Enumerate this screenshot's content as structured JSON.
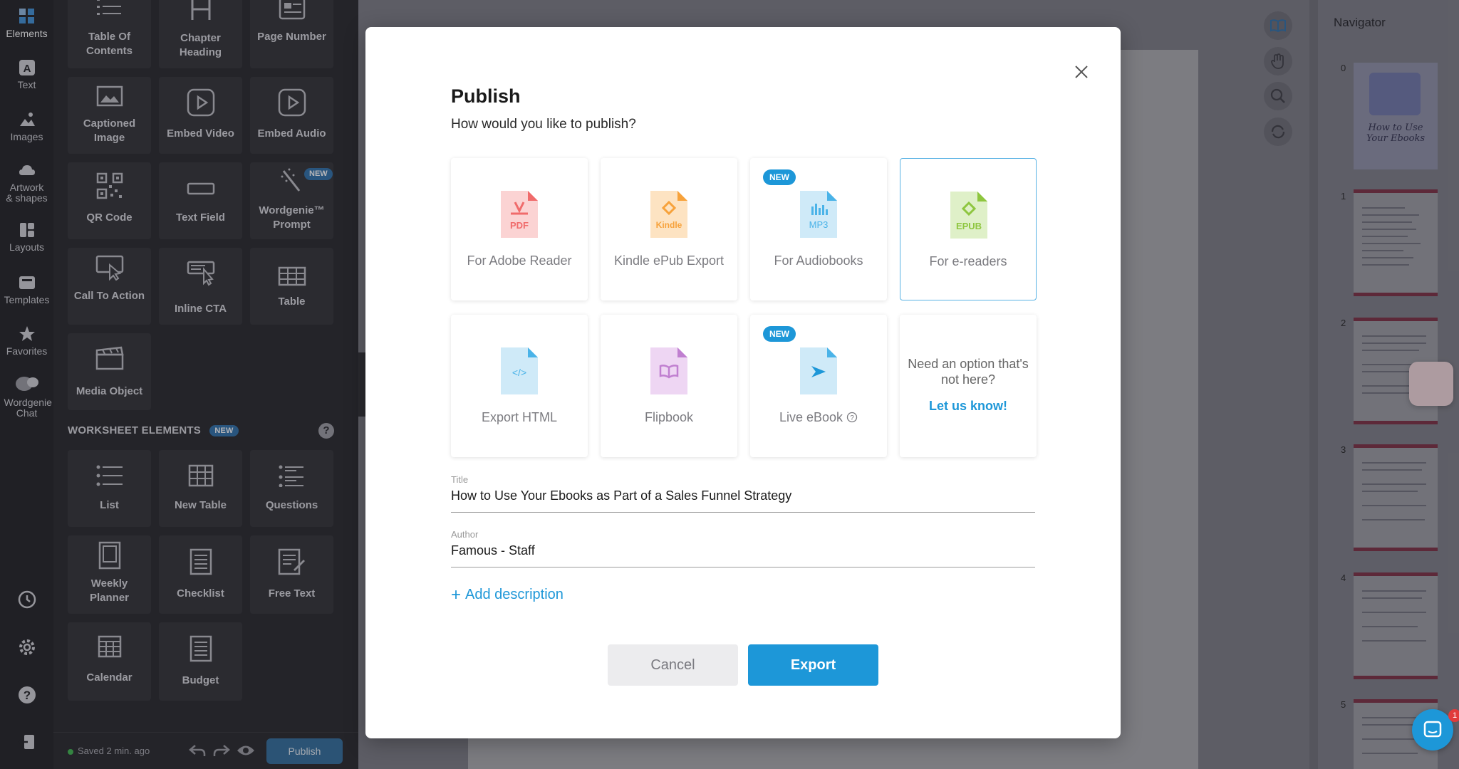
{
  "rail": {
    "items": [
      {
        "label": "Elements"
      },
      {
        "label": "Text"
      },
      {
        "label": "Images"
      },
      {
        "label": "Artwork & shapes"
      },
      {
        "label": "Layouts"
      },
      {
        "label": "Templates"
      },
      {
        "label": "Favorites"
      },
      {
        "label": "Wordgenie Chat"
      }
    ]
  },
  "panel": {
    "tiles": [
      {
        "label": "Table Of Contents"
      },
      {
        "label": "Chapter Heading"
      },
      {
        "label": "Page Number"
      },
      {
        "label": "Captioned Image"
      },
      {
        "label": "Embed Video"
      },
      {
        "label": "Embed Audio"
      },
      {
        "label": "QR Code"
      },
      {
        "label": "Text Field"
      },
      {
        "label": "Wordgenie™ Prompt",
        "badge": "NEW"
      },
      {
        "label": "Call To Action"
      },
      {
        "label": "Inline CTA"
      },
      {
        "label": "Table"
      },
      {
        "label": "Media Object"
      }
    ],
    "worksheet": {
      "title": "WORKSHEET ELEMENTS",
      "badge": "NEW",
      "help": "?",
      "tiles": [
        {
          "label": "List"
        },
        {
          "label": "New Table"
        },
        {
          "label": "Questions"
        },
        {
          "label": "Weekly Planner"
        },
        {
          "label": "Checklist"
        },
        {
          "label": "Free Text"
        },
        {
          "label": "Calendar"
        },
        {
          "label": "Budget"
        }
      ]
    },
    "bottom": {
      "saved": "Saved 2 min. ago",
      "publish": "Publish"
    }
  },
  "navigator": {
    "title": "Navigator",
    "thumb_title": "How to Use Your Ebooks",
    "pages": [
      "0",
      "1",
      "2",
      "3",
      "4",
      "5"
    ]
  },
  "modal": {
    "title": "Publish",
    "subtitle": "How would you like to publish?",
    "options": [
      {
        "label": "For Adobe Reader",
        "icon_text": "PDF",
        "color": "#f06b6b",
        "new": false,
        "selected": false
      },
      {
        "label": "Kindle ePub Export",
        "icon_text": "Kindle",
        "color": "#f7a23b",
        "new": false,
        "selected": false
      },
      {
        "label": "For Audiobooks",
        "icon_text": "MP3",
        "color": "#4ab3e8",
        "new": true,
        "selected": false
      },
      {
        "label": "For e-readers",
        "icon_text": "EPUB",
        "color": "#8ec63f",
        "new": false,
        "selected": true
      },
      {
        "label": "Export HTML",
        "icon_text": "</>",
        "color": "#4ab3e8",
        "new": false,
        "selected": false
      },
      {
        "label": "Flipbook",
        "icon_text": "",
        "color": "#c07fd0",
        "new": false,
        "selected": false
      },
      {
        "label": "Live eBook",
        "icon_text": "",
        "color": "#4ab3e8",
        "new": true,
        "selected": false
      }
    ],
    "new_badge": "NEW",
    "ask": {
      "text": "Need an option that's not here?",
      "link": "Let us know!"
    },
    "title_field": {
      "label": "Title",
      "value": "How to Use Your Ebooks as Part of a Sales Funnel Strategy"
    },
    "author_field": {
      "label": "Author",
      "value": "Famous - Staff"
    },
    "add_description": "Add description",
    "cancel": "Cancel",
    "export": "Export"
  },
  "chat": {
    "count": "1"
  }
}
